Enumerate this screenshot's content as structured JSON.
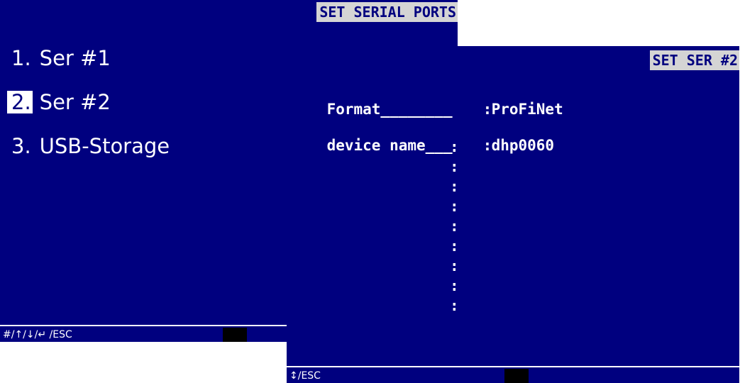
{
  "left_screen": {
    "title": "SET SERIAL PORTS",
    "menu": [
      {
        "number": "1.",
        "label": "Ser #1"
      },
      {
        "number": "2.",
        "label": "Ser #2",
        "selected": true
      },
      {
        "number": "3.",
        "label": "USB-Storage"
      }
    ],
    "status_text": "#/↑/↓/↵ /ESC"
  },
  "right_screen": {
    "title": "SET SER #2",
    "fields": [
      {
        "label": "Format________",
        "separator": ":",
        "value": "ProFiNet"
      },
      {
        "label": "device name___",
        "separator": ":",
        "value": "dhp0060"
      }
    ],
    "empty_separators": [
      ":",
      ":",
      ":",
      ":",
      ":",
      ":",
      ":",
      ":",
      ":"
    ],
    "status_text": "↕/ESC"
  },
  "colors": {
    "screen_bg": "#00007f",
    "title_bg": "#d4d4d4",
    "text": "#ffffff",
    "cursor_block": "#000000"
  }
}
